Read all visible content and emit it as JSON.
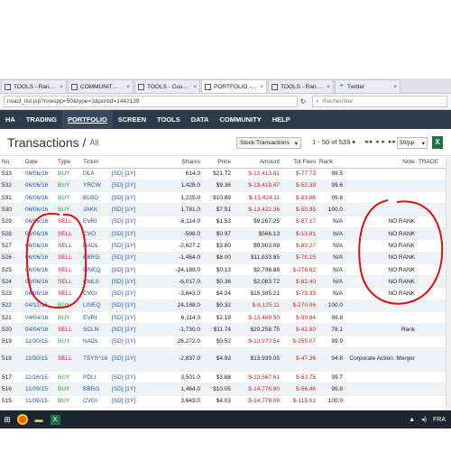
{
  "tabs": [
    {
      "label": "TOOLS - Ran…",
      "active": false
    },
    {
      "label": "COMMUNIT…",
      "active": false
    },
    {
      "label": "TOOLS - Cus…",
      "active": false
    },
    {
      "label": "PORTFOLIO -…",
      "active": true
    },
    {
      "label": "TOOLS - Ran…",
      "active": false
    },
    {
      "label": "Twitter",
      "active": false
    }
  ],
  "url": "nsact_list.jsp?rowspp=50&type=3&portid=1442139",
  "search_placeholder": "Rechercher",
  "nav": [
    "HA",
    "TRADING",
    "PORTFOLIO",
    "SCREEN",
    "TOOLS",
    "DATA",
    "COMMUNITY",
    "HELP"
  ],
  "nav_active": "PORTFOLIO",
  "page": {
    "title": "Transactions /",
    "subtitle": "All"
  },
  "controls": {
    "type_select": "Stock Transactions",
    "range": "1 - 50 of 533",
    "pager": "◂◂ ◂ ▸ ▸▸",
    "per_page": "50/pp",
    "excel": "X"
  },
  "columns": [
    "No",
    "Date",
    "Type",
    "Ticker",
    "",
    "Shares",
    "Price",
    "Amount",
    "Tot Fees",
    "Rank",
    "Note",
    "TRADE"
  ],
  "rows": [
    {
      "no": "533",
      "date": "06/06/16",
      "type": "BUY",
      "ticker": "DLA",
      "links": "[SD] [1Y]",
      "shares": "614.0",
      "price": "$21.72",
      "amount": "$-13,413.81",
      "fees": "$-77.73",
      "rank": "99.5",
      "note": ""
    },
    {
      "no": "532",
      "date": "06/06/16",
      "type": "BUY",
      "ticker": "YRCW",
      "links": "[SD] [1Y]",
      "shares": "1,428.0",
      "price": "$9.36",
      "amount": "$-13,418.47",
      "fees": "$-52.39",
      "rank": "99.6",
      "note": ""
    },
    {
      "no": "531",
      "date": "06/06/16",
      "type": "BUY",
      "ticker": "BLBD",
      "links": "[SD] [1Y]",
      "shares": "1,225.0",
      "price": "$10.89",
      "amount": "$-13,424.11",
      "fees": "$-83.86",
      "rank": "99.8",
      "note": ""
    },
    {
      "no": "530",
      "date": "06/06/16",
      "type": "BUY",
      "ticker": "JAKK",
      "links": "[SD] [1Y]",
      "shares": "1,781.0",
      "price": "$7.51",
      "amount": "$-13,422.36",
      "fees": "$-55.95",
      "rank": "100.0",
      "note": ""
    },
    {
      "no": "529",
      "date": "06/06/16",
      "type": "SELL",
      "ticker": "EVRI",
      "links": "[SD] [1Y]",
      "shares": "-6,114.0",
      "price": "$1.53",
      "amount": "$9,267.25",
      "fees": "$-87.17",
      "rank": "N/A",
      "note": "NO RANK"
    },
    {
      "no": "528",
      "date": "06/06/16",
      "type": "SELL",
      "ticker": "CVO",
      "links": "[SD] [1Y]",
      "shares": "-598.0",
      "price": "$0.97",
      "amount": "$566.13",
      "fees": "$-13.81",
      "rank": "N/A",
      "note": "NO RANK"
    },
    {
      "no": "527",
      "date": "06/06/16",
      "type": "SELL",
      "ticker": "NADL",
      "links": "[SD] [1Y]",
      "shares": "-2,627.2",
      "price": "$3.80",
      "amount": "$9,903.09",
      "fees": "$-80.27",
      "rank": "N/A",
      "note": "NO RANK"
    },
    {
      "no": "526",
      "date": "06/06/16",
      "type": "SELL",
      "ticker": "BBRG",
      "links": "[SD] [1Y]",
      "shares": "-1,464.0",
      "price": "$8.00",
      "amount": "$11,633.85",
      "fees": "$-78.15",
      "rank": "N/A",
      "note": "NO RANK"
    },
    {
      "no": "525",
      "date": "06/06/16",
      "type": "SELL",
      "ticker": "LINEQ",
      "links": "[SD] [1Y]",
      "shares": "-24,188.0",
      "price": "$0.13",
      "amount": "$2,798.88",
      "fees": "$-276.62",
      "rank": "N/A",
      "note": "NO RANK"
    },
    {
      "no": "524",
      "date": "06/06/16",
      "type": "SELL",
      "ticker": "CMLS",
      "links": "[SD] [1Y]",
      "shares": "-6,017.0",
      "price": "$0.36",
      "amount": "$2,083.72",
      "fees": "$-82.40",
      "rank": "N/A",
      "note": "NO RANK"
    },
    {
      "no": "523",
      "date": "06/06/16",
      "type": "SELL",
      "ticker": "CVGI",
      "links": "[SD] [1Y]",
      "shares": "-3,643.0",
      "price": "$4.24",
      "amount": "$15,385.21",
      "fees": "$-79.33",
      "rank": "N/A",
      "note": "NO RANK"
    },
    {
      "no": "522",
      "date": "04/11/16",
      "type": "BUY",
      "ticker": "LINEQ",
      "links": "[SD] [1Y]",
      "shares": "24,188.0",
      "price": "$0.32",
      "amount": "$-8,125.11",
      "fees": "$-270.06",
      "rank": "100.0",
      "note": ""
    },
    {
      "no": "521",
      "date": "04/04/16",
      "type": "BUY",
      "ticker": "EVRI",
      "links": "[SD] [1Y]",
      "shares": "6,114.0",
      "price": "$2.19",
      "amount": "$-13,489.50",
      "fees": "$-99.84",
      "rank": "99.8",
      "note": ""
    },
    {
      "no": "520",
      "date": "04/04/16",
      "type": "SELL",
      "ticker": "SCLN",
      "links": "[SD] [1Y]",
      "shares": "-1,730.0",
      "price": "$11.74",
      "amount": "$20,258.75",
      "fees": "$-42.80",
      "rank": "78.1",
      "note": "Rank"
    },
    {
      "no": "519",
      "date": "11/30/15",
      "type": "BUY",
      "ticker": "NADL",
      "links": "[SD] [1Y]",
      "shares": "26,272.0",
      "price": "$0.52",
      "amount": "$-13,970.54",
      "fees": "$-355.07",
      "rank": "99.9",
      "note": ""
    },
    {
      "no": "518",
      "date": "11/30/15",
      "type": "SELL",
      "ticker": "TSYS^16",
      "links": "[SD] [1Y]",
      "shares": "-2,837.0",
      "price": "$4.93",
      "amount": "$13,939.05",
      "fees": "$-47.36",
      "rank": "94.8",
      "note": "Corporate Action: Merger",
      "tall": true
    },
    {
      "no": "517",
      "date": "11/16/15",
      "type": "BUY",
      "ticker": "PDLI",
      "links": "[SD] [1Y]",
      "shares": "3,501.0",
      "price": "$3.88",
      "amount": "$-13,567.61",
      "fees": "$-53.75",
      "rank": "99.7",
      "note": ""
    },
    {
      "no": "516",
      "date": "11/09/15",
      "type": "BUY",
      "ticker": "BBRG",
      "links": "[SD] [1Y]",
      "shares": "1,464.0",
      "price": "$10.05",
      "amount": "$-14,776.90",
      "fees": "$-56.46",
      "rank": "99.8",
      "note": ""
    },
    {
      "no": "515",
      "date": "11/09/15",
      "type": "BUY",
      "ticker": "CVGI",
      "links": "[SD] [1Y]",
      "shares": "3,643.0",
      "price": "$4.03",
      "amount": "$-14,778.09",
      "fees": "$-115.01",
      "rank": "100.0",
      "note": ""
    }
  ],
  "taskbar": {
    "time": "FRA",
    "lang": "FRA"
  },
  "colors": {
    "nav_bg": "#2d3a4a",
    "buy": "#2a9d3a",
    "sell": "#d42020",
    "link": "#2457a8",
    "annotation": "#e01010"
  }
}
